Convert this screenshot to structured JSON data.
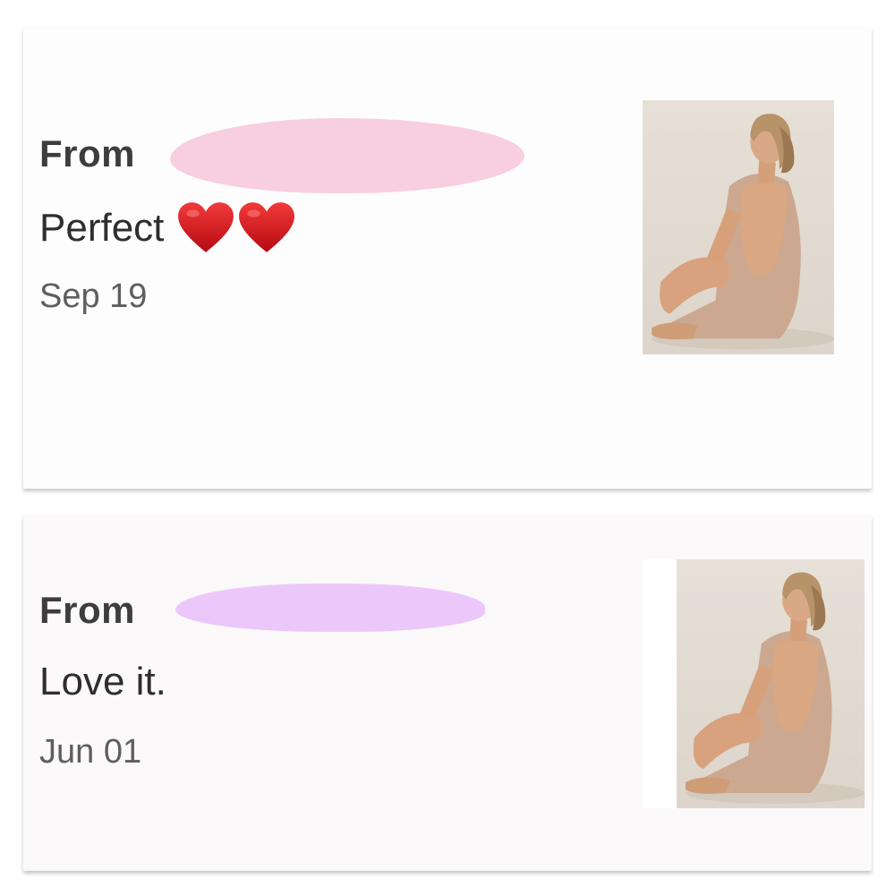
{
  "reviews": [
    {
      "from_label": "From",
      "sender_redaction_color": "#f8cfe0",
      "message": "Perfect",
      "emoji": [
        "red-heart",
        "red-heart"
      ],
      "date": "Sep 19",
      "thumbnail": "product-photo-backless-dress"
    },
    {
      "from_label": "From",
      "sender_redaction_color": "#ecc8fa",
      "message": "Love it.",
      "emoji": [],
      "date": "Jun 01",
      "thumbnail": "product-photo-backless-dress"
    }
  ],
  "colors": {
    "heart": "#d0141a",
    "text_primary": "#2e2e2e",
    "text_secondary": "#5e5e5e"
  }
}
